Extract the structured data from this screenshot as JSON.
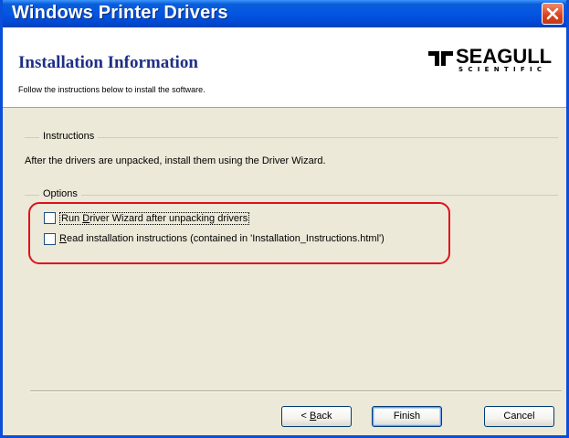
{
  "window": {
    "title": "Windows Printer Drivers"
  },
  "header": {
    "title": "Installation Information",
    "subtitle": "Follow the instructions below to install the software.",
    "logo_word": "SEAGULL",
    "logo_sub": "SCIENTIFIC"
  },
  "instructions": {
    "label": "Instructions",
    "text": "After the drivers are unpacked, install them using the Driver Wizard."
  },
  "options": {
    "label": "Options",
    "items": [
      {
        "mnemonic": "D",
        "before": "Run ",
        "after": "river Wizard after unpacking drivers",
        "checked": false
      },
      {
        "mnemonic": "R",
        "before": "",
        "after": "ead installation instructions (contained in 'Installation_Instructions.html')",
        "checked": false
      }
    ]
  },
  "buttons": {
    "back_prefix": "< ",
    "back_mnemonic": "B",
    "back_rest": "ack",
    "finish": "Finish",
    "cancel": "Cancel"
  },
  "colors": {
    "titlebar": "#0355e3",
    "highlight": "#e0101a",
    "dialog_bg": "#ece9d8"
  }
}
